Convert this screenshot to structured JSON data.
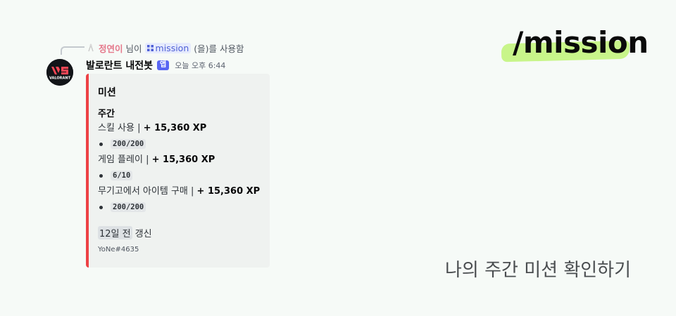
{
  "command_line": {
    "user": "정연이",
    "suffix_before": "님이",
    "command": "mission",
    "suffix_after": "(을)를 사용함"
  },
  "message": {
    "bot_name": "발로란트 내전봇",
    "badge": "앱",
    "timestamp": "오늘 오후 6:44",
    "avatar_logo_text": "VALORANT"
  },
  "embed": {
    "accent_color": "#ed4245",
    "title": "미션",
    "section": "주간",
    "missions": [
      {
        "name": "스킬 사용",
        "sep": "|",
        "xp": "+ 15,360 XP",
        "progress": "200/200"
      },
      {
        "name": "게임 플레이",
        "sep": "|",
        "xp": "+ 15,360 XP",
        "progress": "6/10"
      },
      {
        "name": "무기고에서 아이템 구매",
        "sep": "|",
        "xp": "+ 15,360 XP",
        "progress": "200/200"
      }
    ],
    "updated_time": "12일 전",
    "updated_label": "갱신",
    "footer": "YoNe#4635"
  },
  "promo": {
    "command_title": "/mission",
    "tagline": "나의 주간 미션 확인하기",
    "highlight_color": "#c8f58a"
  }
}
